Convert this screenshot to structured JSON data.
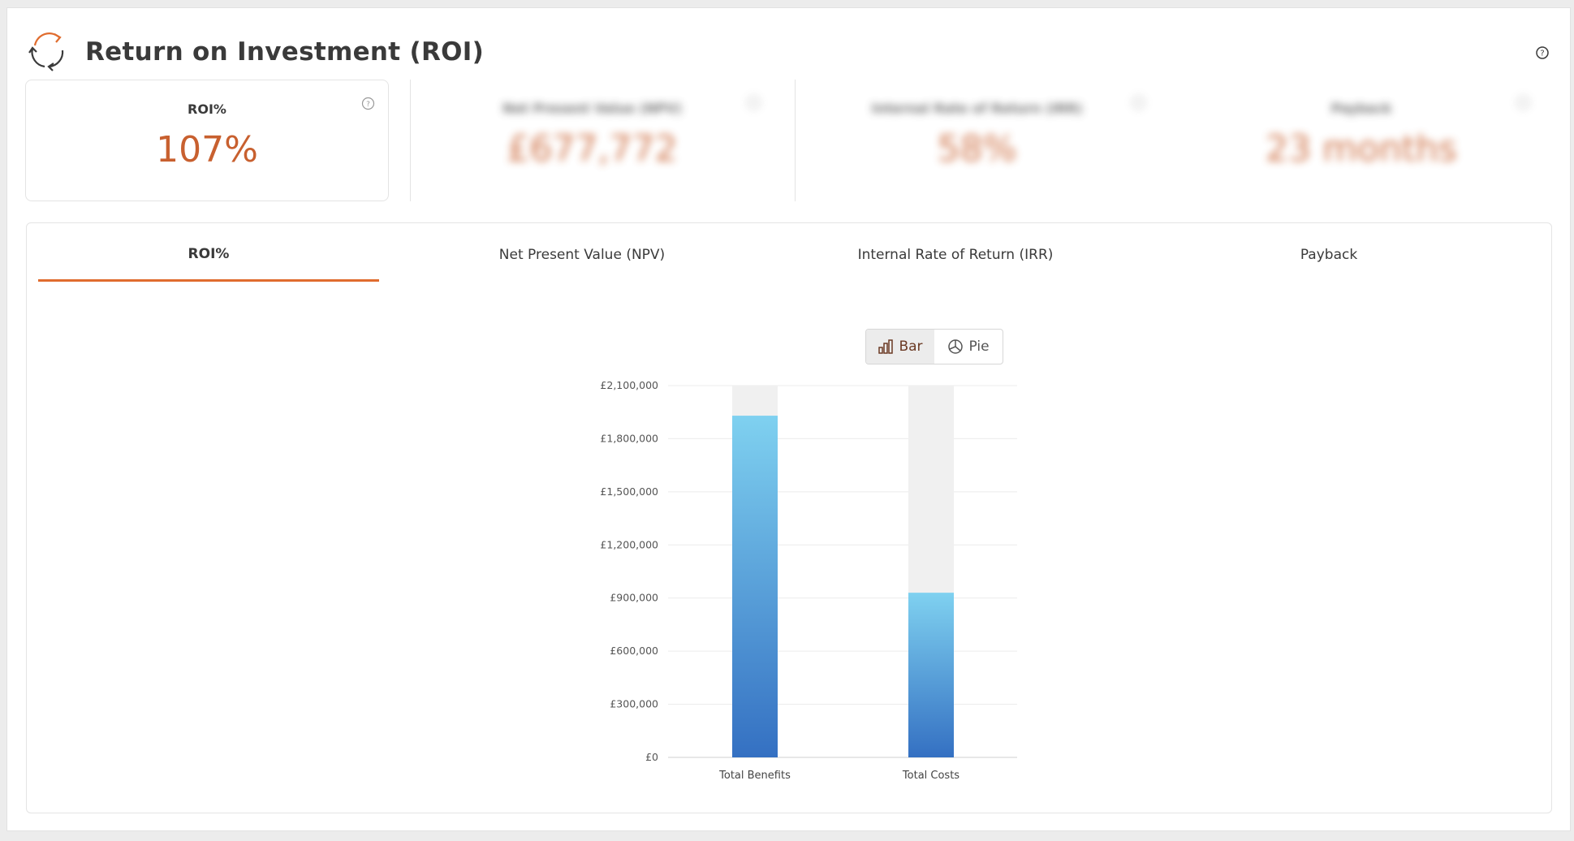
{
  "header": {
    "title": "Return on Investment (ROI)",
    "logo_icon": "refresh-cycle-icon",
    "help_icon": "question-circle-icon"
  },
  "kpis": [
    {
      "label": "ROI%",
      "value": "107%",
      "active": true
    },
    {
      "label": "Net Present Value (NPV)",
      "value": "£677,772",
      "active": false
    },
    {
      "label": "Internal Rate of Return (IRR)",
      "value": "58%",
      "active": false
    },
    {
      "label": "Payback",
      "value": "23 months",
      "active": false
    }
  ],
  "tabs": [
    {
      "label": "ROI%",
      "active": true
    },
    {
      "label": "Net Present Value (NPV)",
      "active": false
    },
    {
      "label": "Internal Rate of Return (IRR)",
      "active": false
    },
    {
      "label": "Payback",
      "active": false
    }
  ],
  "chart_toggle": {
    "bar_label": "Bar",
    "pie_label": "Pie",
    "selected": "Bar"
  },
  "colors": {
    "accent": "#e06c2e",
    "kpi_value": "#c8602f",
    "bar_top": "#7fd1f0",
    "bar_bottom": "#3470c2",
    "bar_track": "#f0f0f0"
  },
  "chart_data": {
    "type": "bar",
    "categories": [
      "Total Benefits",
      "Total Costs"
    ],
    "values": [
      1930000,
      930000
    ],
    "ylim": [
      0,
      2100000
    ],
    "yticks": [
      0,
      300000,
      600000,
      900000,
      1200000,
      1500000,
      1800000,
      2100000
    ],
    "ytick_labels": [
      "£0",
      "£300,000",
      "£600,000",
      "£900,000",
      "£1,200,000",
      "£1,500,000",
      "£1,800,000",
      "£2,100,000"
    ],
    "grid": true,
    "xlabel": "",
    "ylabel": ""
  }
}
